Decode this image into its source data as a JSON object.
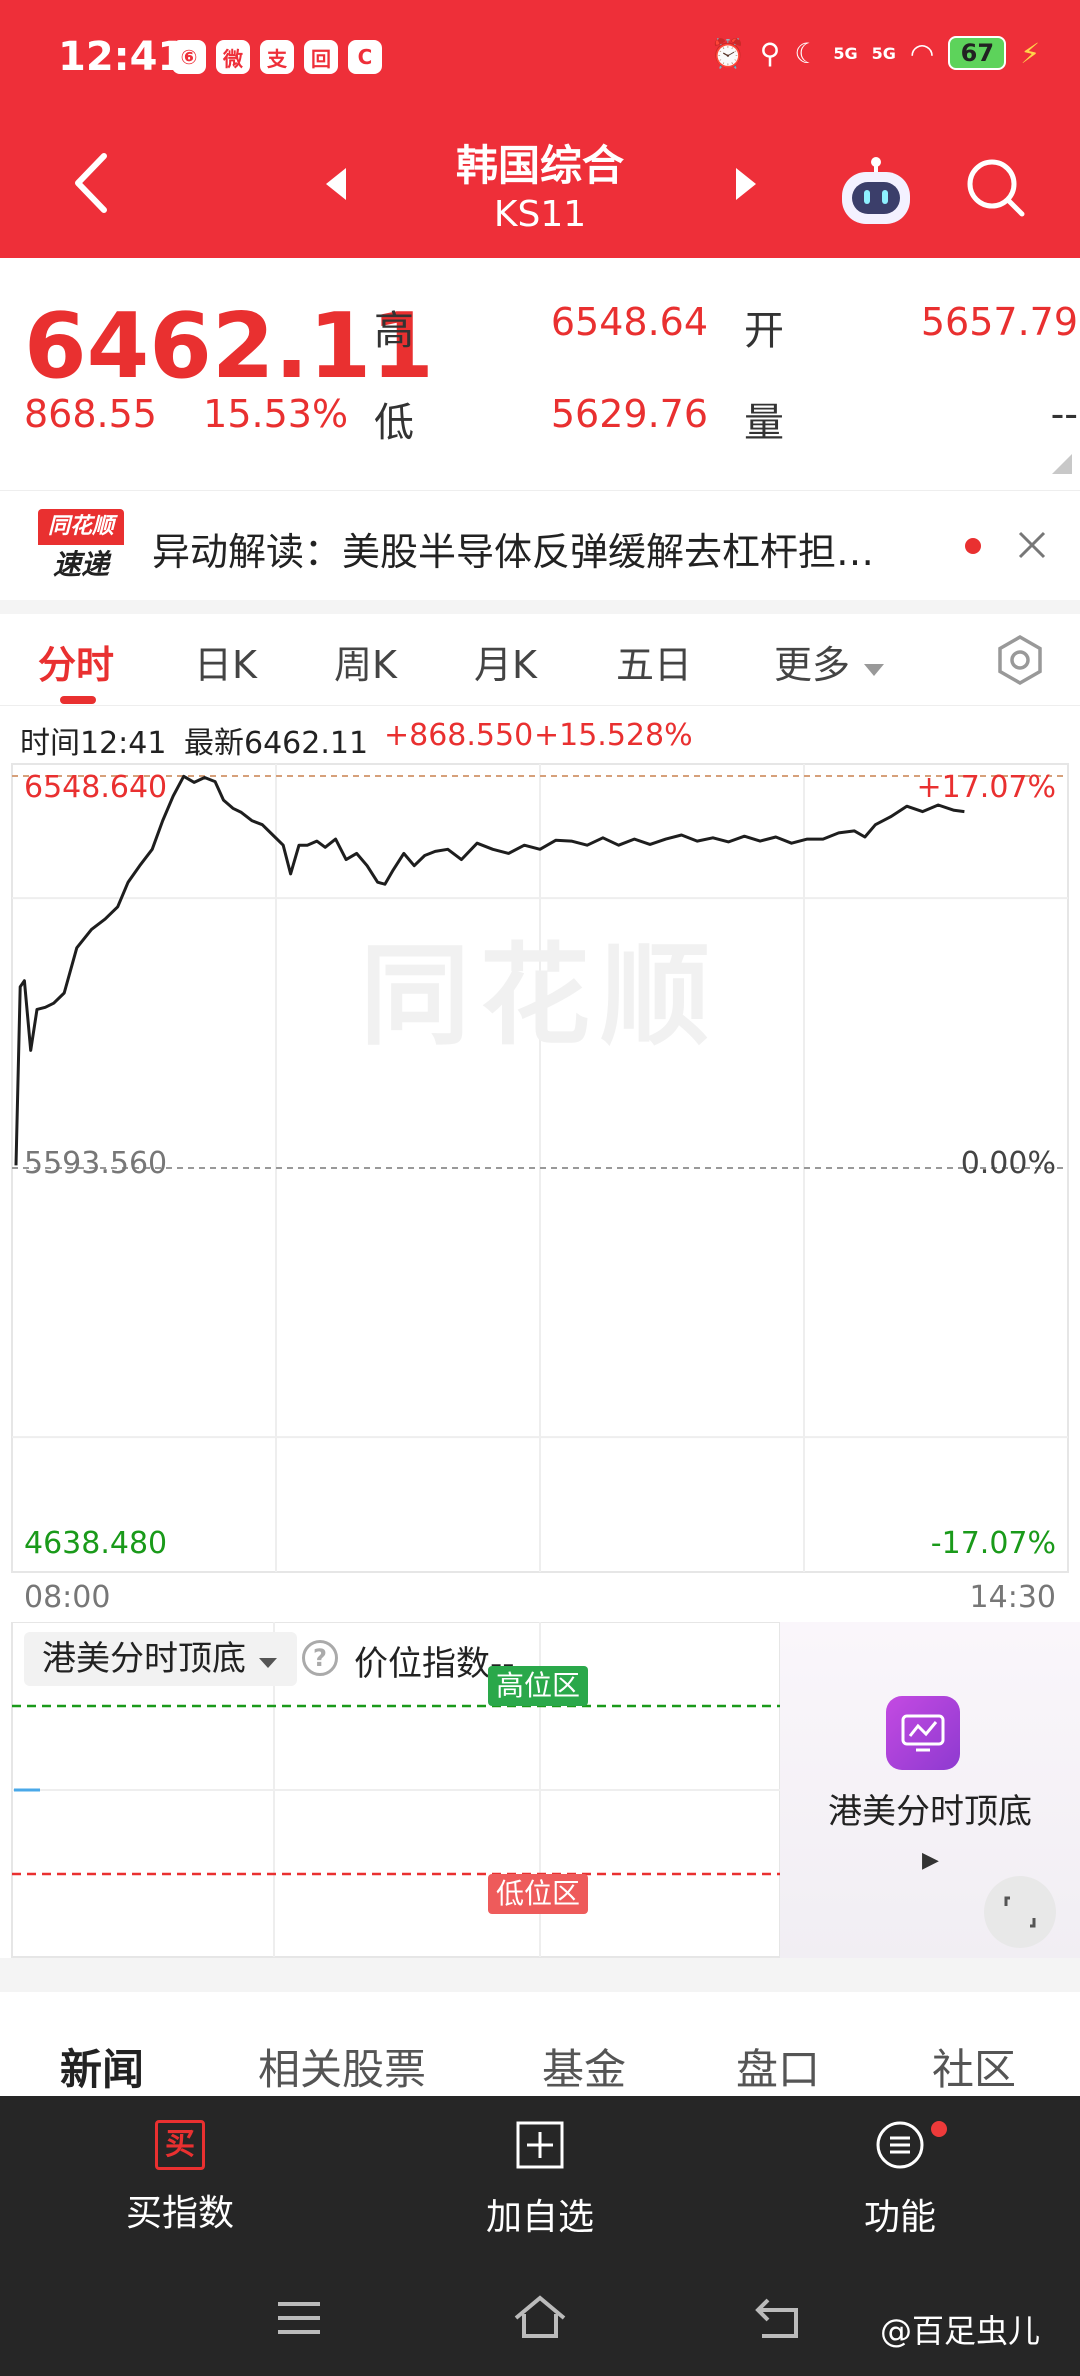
{
  "status_bar": {
    "time": "12:41",
    "app_icons": [
      "⑥",
      "微",
      "支",
      "回",
      "C"
    ],
    "battery": "67",
    "signal1": "5G",
    "signal2": "5G"
  },
  "header": {
    "title": "韩国综合",
    "code": "KS11"
  },
  "quote": {
    "price": "6462.11",
    "change": "868.55",
    "change_pct": "15.53%",
    "high_label": "高",
    "high": "6548.64",
    "open_label": "开",
    "open": "5657.79",
    "low_label": "低",
    "low": "5629.76",
    "volume_label": "量",
    "volume": "--"
  },
  "news_tip": {
    "logo_top": "同花顺",
    "logo_bottom": "速递",
    "text": "异动解读：美股半导体反弹缓解去杠杆担…"
  },
  "tabs": [
    "分时",
    "日K",
    "周K",
    "月K",
    "五日",
    "更多"
  ],
  "info_line": {
    "time": "时间12:41",
    "latest": "最新6462.11",
    "change": "+868.550",
    "change_pct": "+15.528%"
  },
  "chart_data": {
    "type": "line",
    "title": "",
    "xlabel": "",
    "ylabel": "",
    "x_start_label": "08:00",
    "x_end_label": "14:30",
    "prev_close": 5593.56,
    "ylim": [
      4638.48,
      6548.64
    ],
    "y_tick_labels_left": [
      "6548.640",
      "5593.560",
      "4638.480"
    ],
    "y_tick_labels_right": [
      "+17.07%",
      "0.00%",
      "-17.07%"
    ],
    "grid": true,
    "watermark": "同花顺",
    "series": [
      {
        "x": [
          0.0,
          0.004,
          0.008,
          0.014,
          0.02,
          0.028,
          0.036,
          0.046,
          0.058,
          0.072,
          0.085,
          0.097,
          0.107,
          0.118,
          0.13,
          0.14,
          0.15,
          0.16,
          0.17,
          0.18,
          0.19,
          0.198,
          0.207,
          0.215,
          0.225,
          0.235,
          0.245,
          0.255,
          0.262,
          0.27,
          0.278,
          0.287,
          0.295,
          0.305,
          0.315,
          0.325,
          0.335,
          0.345,
          0.352,
          0.36,
          0.37,
          0.38,
          0.39,
          0.4,
          0.412,
          0.425,
          0.44,
          0.455,
          0.47,
          0.485,
          0.5,
          0.515,
          0.53,
          0.545,
          0.56,
          0.575,
          0.59,
          0.605,
          0.62,
          0.635,
          0.65,
          0.665,
          0.68,
          0.695,
          0.71,
          0.725,
          0.74,
          0.755,
          0.77,
          0.785,
          0.8,
          0.81,
          0.82,
          0.835,
          0.85,
          0.865,
          0.88,
          0.895,
          0.905
        ],
        "values": [
          5600,
          6035,
          6050,
          5880,
          5980,
          5985,
          5995,
          6020,
          6130,
          6175,
          6200,
          6230,
          6290,
          6330,
          6370,
          6440,
          6500,
          6548,
          6533,
          6545,
          6535,
          6490,
          6470,
          6460,
          6440,
          6430,
          6405,
          6380,
          6310,
          6380,
          6380,
          6390,
          6375,
          6395,
          6345,
          6360,
          6330,
          6290,
          6285,
          6320,
          6360,
          6330,
          6355,
          6365,
          6370,
          6345,
          6385,
          6370,
          6360,
          6380,
          6370,
          6392,
          6390,
          6380,
          6398,
          6380,
          6395,
          6382,
          6395,
          6405,
          6390,
          6398,
          6388,
          6402,
          6390,
          6400,
          6385,
          6395,
          6395,
          6410,
          6415,
          6400,
          6430,
          6450,
          6475,
          6462,
          6478,
          6465,
          6462
        ]
      }
    ]
  },
  "indicator": {
    "name": "港美分时顶底",
    "help": "?",
    "label": "价位指数--",
    "high_zone": "高位区",
    "low_zone": "低位区",
    "promo_title": "港美分时顶底"
  },
  "bottom_tabs": [
    "新闻",
    "相关股票",
    "基金",
    "盘口",
    "社区"
  ],
  "actions": {
    "buy_icon": "买",
    "buy": "买指数",
    "add": "加自选",
    "func": "功能"
  },
  "watermark_user": "@百足虫儿",
  "colors": {
    "brand_red": "#ee2f39",
    "up_red": "#e93030",
    "down_green": "#1a9a1a",
    "dark_bar": "#262626"
  }
}
